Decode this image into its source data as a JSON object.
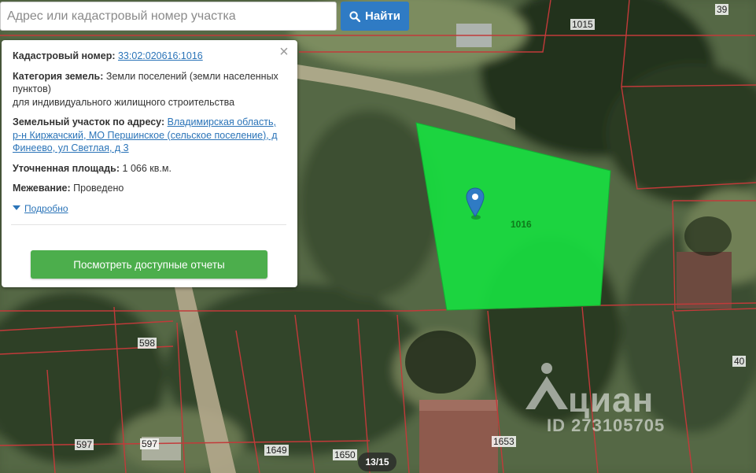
{
  "search": {
    "placeholder": "Адрес или кадастровый номер участка",
    "button_label": "Найти"
  },
  "popup": {
    "cadastral_label": "Кадастровый номер:",
    "cadastral_value": "33:02:020616:1016",
    "category_label": "Категория земель:",
    "category_value": "Земли поселений (земли населенных пунктов)",
    "category_use": "для индивидуального жилищного строительства",
    "address_label": "Земельный участок по адресу:",
    "address_value": "Владимирская область, р-н Киржачский, МО Першинское (сельское поселение), д Финеево, ул Светлая, д 3",
    "area_label": "Уточненная площадь:",
    "area_value": "1 066 кв.м.",
    "survey_label": "Межевание:",
    "survey_value": "Проведено",
    "more_label": "Подробно",
    "report_button": "Посмотреть доступные отчеты"
  },
  "map": {
    "selected_plot_label": "1016",
    "plot_labels": [
      "1015",
      "39",
      "40",
      "598",
      "597",
      "597",
      "1649",
      "1650",
      "1653"
    ],
    "highlight_color": "#18dd40",
    "boundary_color": "#c23a3a"
  },
  "gallery": {
    "counter": "13/15"
  },
  "watermark": {
    "brand": "циан",
    "id": "ID 273105705"
  },
  "colors": {
    "accent_blue": "#2f7bc4",
    "accent_green": "#4cae4c"
  }
}
